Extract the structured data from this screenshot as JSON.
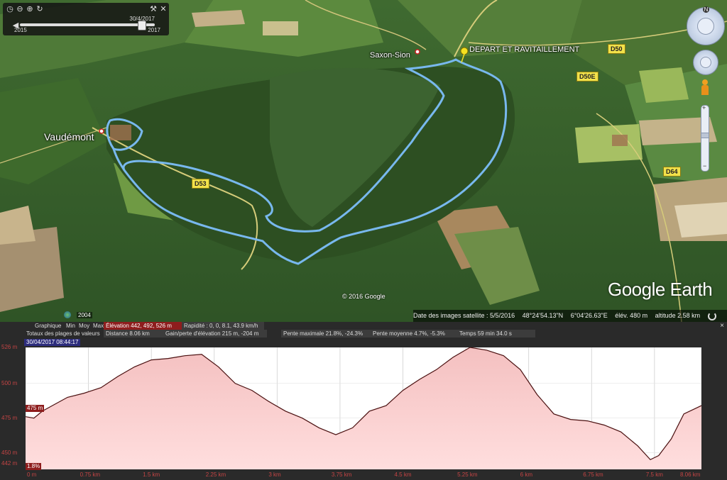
{
  "timeslider": {
    "start_year": "2015",
    "end_year": "2017",
    "current_date": "30/4/2017",
    "position": 0.9
  },
  "map": {
    "labels": {
      "vaudemont": "Vaudémont",
      "saxon_sion": "Saxon-Sion",
      "depart": "DEPART ET RAVITAILLEMENT"
    },
    "roads": {
      "d53": "D53",
      "d50": "D50",
      "d50e": "D50E",
      "d64": "D64"
    },
    "copyright": "© 2016 Google",
    "brand": "Google Earth",
    "imagery_year": "2004",
    "route_color": "#6fb4ee"
  },
  "statusbar": {
    "imagery_date": "Date des images satellite : 5/5/2016",
    "lat": "48°24'54.13\"N",
    "lon": "6°04'26.63\"E",
    "elev": "élév.  480 m",
    "altitude": "altitude   2.58 km"
  },
  "profile": {
    "row1": {
      "graphique": "Graphique",
      "min": "Min",
      "moy": "Moy",
      "max": "Max",
      "elevation": "Élévation   442, 492, 526 m",
      "rapidite": "Rapidité : 0, 0, 8.1, 43.9 km/h"
    },
    "row2": {
      "totaux": "Totaux des plages de valeurs",
      "distance": "Distance   8.06 km",
      "gain": "Gain/perte d'élévation   215 m, -204 m",
      "pente_max": "Pente maximale   21.8%, -24.3%",
      "pente_moy": "Pente moyenne   4.7%, -5.3%",
      "temps": "Temps   59 min 34.0 s"
    },
    "date_chip": "30/04/2017 08:44:17",
    "current_elev": "475 m",
    "current_slope": "1.8%",
    "close": "×"
  },
  "chart_data": {
    "type": "area",
    "xlabel": "",
    "ylabel": "",
    "xlim": [
      0,
      8.06
    ],
    "ylim": [
      438,
      526
    ],
    "x_ticks": [
      "0 m",
      "0.75 km",
      "1.5 km",
      "2.25 km",
      "3 km",
      "3.75 km",
      "4.5 km",
      "5.25 km",
      "6 km",
      "6.75 km",
      "7.5 km",
      "8.06 km"
    ],
    "x_tick_values": [
      0,
      0.75,
      1.5,
      2.25,
      3,
      3.75,
      4.5,
      5.25,
      6,
      6.75,
      7.5,
      8.06
    ],
    "y_ticks": [
      "442 m",
      "450 m",
      "475 m",
      "500 m",
      "526 m"
    ],
    "y_tick_values": [
      442,
      450,
      475,
      500,
      526
    ],
    "series": [
      {
        "x": [
          0,
          0.1,
          0.2,
          0.35,
          0.5,
          0.7,
          0.9,
          1.1,
          1.3,
          1.5,
          1.7,
          1.9,
          2.1,
          2.3,
          2.5,
          2.7,
          2.9,
          3.1,
          3.3,
          3.5,
          3.7,
          3.9,
          4.1,
          4.3,
          4.5,
          4.7,
          4.9,
          5.1,
          5.3,
          5.5,
          5.7,
          5.9,
          6.1,
          6.3,
          6.5,
          6.7,
          6.9,
          7.1,
          7.3,
          7.45,
          7.55,
          7.7,
          7.85,
          8.06
        ],
        "y": [
          476,
          475,
          480,
          485,
          490,
          493,
          497,
          505,
          512,
          517,
          518,
          520,
          521,
          512,
          500,
          495,
          487,
          480,
          475,
          468,
          463,
          468,
          480,
          484,
          495,
          503,
          510,
          519,
          526,
          524,
          520,
          510,
          492,
          478,
          474,
          473,
          470,
          465,
          455,
          445,
          448,
          460,
          478,
          484
        ]
      }
    ],
    "grid": true
  },
  "colors": {
    "fill_top": "#f4c0c0",
    "fill_bottom": "#ffdede",
    "line": "#4a1010",
    "label": "#c44444"
  }
}
